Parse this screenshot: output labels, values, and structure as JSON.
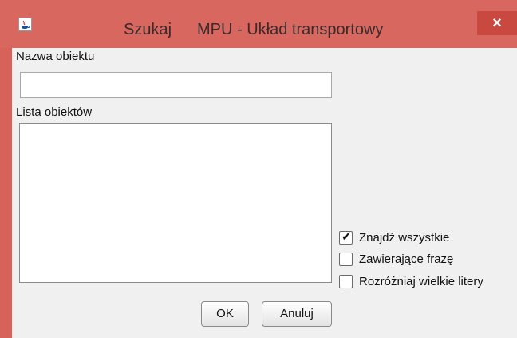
{
  "window": {
    "title_prefix": "Szukaj",
    "title_main": "MPU - Układ transportowy",
    "close_glyph": "×",
    "icon": "java-icon"
  },
  "form": {
    "name_label": "Nazwa obiektu",
    "name_value": "",
    "list_label": "Lista obiektów",
    "list_items": []
  },
  "options": [
    {
      "label": "Znajdź wszystkie",
      "checked": true
    },
    {
      "label": "Zawierające frazę",
      "checked": false
    },
    {
      "label": "Rozróżniaj wielkie litery",
      "checked": false
    }
  ],
  "buttons": {
    "ok": "OK",
    "cancel": "Anuluj"
  },
  "colors": {
    "titlebar": "#d8675f",
    "close_button": "#c9483f"
  }
}
